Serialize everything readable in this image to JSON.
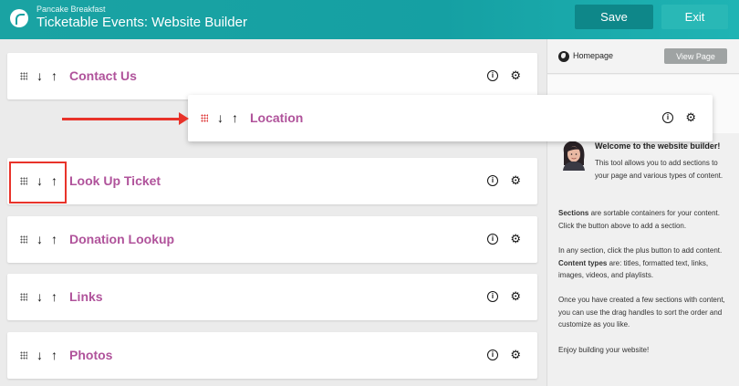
{
  "header": {
    "org_name": "Pancake Breakfast",
    "title": "Ticketable Events: Website Builder",
    "save_label": "Save",
    "exit_label": "Exit"
  },
  "icons": {
    "arrow_down": "↓",
    "arrow_up": "↑",
    "info": "i",
    "gear": "⚙"
  },
  "sections": [
    {
      "title": "Contact Us"
    },
    {
      "title": "Look Up Ticket"
    },
    {
      "title": "Donation Lookup"
    },
    {
      "title": "Links"
    },
    {
      "title": "Photos"
    }
  ],
  "dragging_section": {
    "title": "Location"
  },
  "annotation_color": "#e8332a",
  "sidebar": {
    "homepage_label": "Homepage",
    "view_page_label": "View Page",
    "welcome_title": "Welcome to the website builder!",
    "intro": "This tool allows you to add sections to your page and various types of content.",
    "sections_strong": "Sections",
    "sections_text": " are sortable containers for your content. Click the button above to add a section.",
    "content_text_1": "In any section, click the plus button to add content. ",
    "content_types_strong": "Content types",
    "content_text_2": " are: titles, formatted text, links, images, videos, and playlists.",
    "drag_text": "Once you have created a few sections with content, you can use the drag handles to sort the order and customize as you like.",
    "enjoy_text": "Enjoy building your website!"
  },
  "colors": {
    "header": "#1aa3a3",
    "save_button": "#0e8789",
    "exit_button": "#29b8b6",
    "section_title": "#b0539b"
  }
}
